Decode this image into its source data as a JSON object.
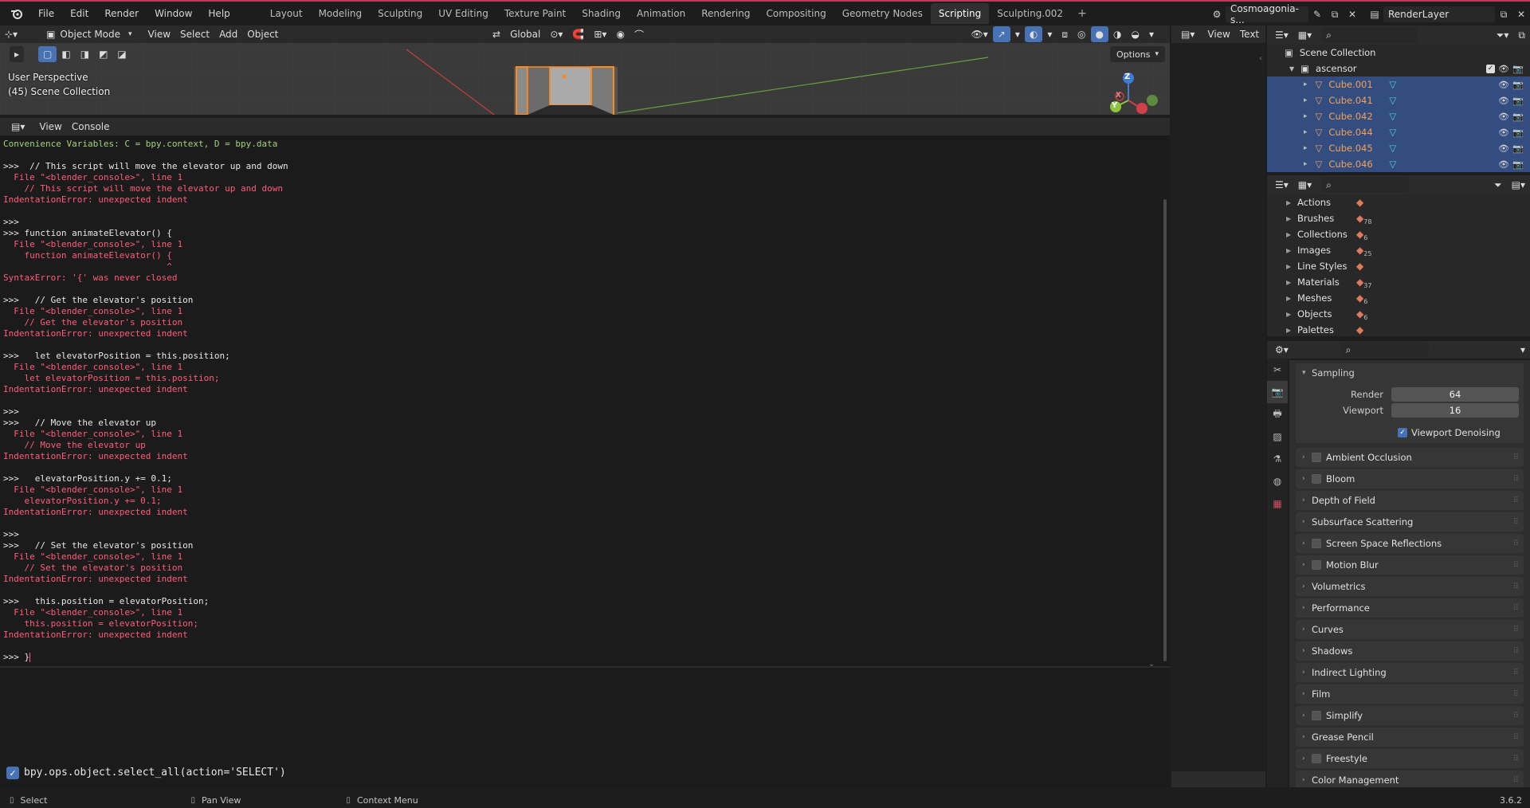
{
  "menu": [
    "File",
    "Edit",
    "Render",
    "Window",
    "Help"
  ],
  "workspaces": [
    "Layout",
    "Modeling",
    "Sculpting",
    "UV Editing",
    "Texture Paint",
    "Shading",
    "Animation",
    "Rendering",
    "Compositing",
    "Geometry Nodes",
    "Scripting",
    "Sculpting.002"
  ],
  "active_workspace": "Scripting",
  "scene_name": "Cosmoagonia-s...",
  "view_layer": "RenderLayer",
  "viewport": {
    "mode": "Object Mode",
    "menus": [
      "View",
      "Select",
      "Add",
      "Object"
    ],
    "transform": "Global",
    "options": "Options",
    "perspective": "User Perspective",
    "collection_info": "(45) Scene Collection",
    "axis_x": "X",
    "axis_y": "Y",
    "axis_z": "Z"
  },
  "console": {
    "menus": [
      "View",
      "Console"
    ],
    "lines": [
      {
        "t": "Convenience Variables: C = bpy.context, D = bpy.data",
        "c": "green"
      },
      {
        "t": "",
        "c": "white"
      },
      {
        "t": ">>>  // This script will move the elevator up and down",
        "c": "white"
      },
      {
        "t": "  File \"<blender_console>\", line 1",
        "c": "red"
      },
      {
        "t": "    // This script will move the elevator up and down",
        "c": "red"
      },
      {
        "t": "IndentationError: unexpected indent",
        "c": "red"
      },
      {
        "t": "",
        "c": "white"
      },
      {
        "t": ">>>",
        "c": "white"
      },
      {
        "t": ">>> function animateElevator() {",
        "c": "white"
      },
      {
        "t": "  File \"<blender_console>\", line 1",
        "c": "red"
      },
      {
        "t": "    function animateElevator() {",
        "c": "red"
      },
      {
        "t": "                               ^",
        "c": "red"
      },
      {
        "t": "SyntaxError: '{' was never closed",
        "c": "red"
      },
      {
        "t": "",
        "c": "white"
      },
      {
        "t": ">>>   // Get the elevator's position",
        "c": "white"
      },
      {
        "t": "  File \"<blender_console>\", line 1",
        "c": "red"
      },
      {
        "t": "    // Get the elevator's position",
        "c": "red"
      },
      {
        "t": "IndentationError: unexpected indent",
        "c": "red"
      },
      {
        "t": "",
        "c": "white"
      },
      {
        "t": ">>>   let elevatorPosition = this.position;",
        "c": "white"
      },
      {
        "t": "  File \"<blender_console>\", line 1",
        "c": "red"
      },
      {
        "t": "    let elevatorPosition = this.position;",
        "c": "red"
      },
      {
        "t": "IndentationError: unexpected indent",
        "c": "red"
      },
      {
        "t": "",
        "c": "white"
      },
      {
        "t": ">>>",
        "c": "white"
      },
      {
        "t": ">>>   // Move the elevator up",
        "c": "white"
      },
      {
        "t": "  File \"<blender_console>\", line 1",
        "c": "red"
      },
      {
        "t": "    // Move the elevator up",
        "c": "red"
      },
      {
        "t": "IndentationError: unexpected indent",
        "c": "red"
      },
      {
        "t": "",
        "c": "white"
      },
      {
        "t": ">>>   elevatorPosition.y += 0.1;",
        "c": "white"
      },
      {
        "t": "  File \"<blender_console>\", line 1",
        "c": "red"
      },
      {
        "t": "    elevatorPosition.y += 0.1;",
        "c": "red"
      },
      {
        "t": "IndentationError: unexpected indent",
        "c": "red"
      },
      {
        "t": "",
        "c": "white"
      },
      {
        "t": ">>>",
        "c": "white"
      },
      {
        "t": ">>>   // Set the elevator's position",
        "c": "white"
      },
      {
        "t": "  File \"<blender_console>\", line 1",
        "c": "red"
      },
      {
        "t": "    // Set the elevator's position",
        "c": "red"
      },
      {
        "t": "IndentationError: unexpected indent",
        "c": "red"
      },
      {
        "t": "",
        "c": "white"
      },
      {
        "t": ">>>   this.position = elevatorPosition;",
        "c": "white"
      },
      {
        "t": "  File \"<blender_console>\", line 1",
        "c": "red"
      },
      {
        "t": "    this.position = elevatorPosition;",
        "c": "red"
      },
      {
        "t": "IndentationError: unexpected indent",
        "c": "red"
      },
      {
        "t": "",
        "c": "white"
      },
      {
        "t": ">>> }",
        "c": "white"
      }
    ],
    "report": "bpy.ops.object.select_all(action='SELECT')"
  },
  "text_editor": {
    "menus": [
      "View",
      "Text"
    ]
  },
  "outliner": {
    "root": "Scene Collection",
    "collection": "ascensor",
    "objects": [
      "Cube.001",
      "Cube.041",
      "Cube.042",
      "Cube.044",
      "Cube.045",
      "Cube.046"
    ]
  },
  "datablocks": [
    {
      "name": "Actions",
      "count": ""
    },
    {
      "name": "Brushes",
      "count": "78"
    },
    {
      "name": "Collections",
      "count": "6"
    },
    {
      "name": "Images",
      "count": "25"
    },
    {
      "name": "Line Styles",
      "count": ""
    },
    {
      "name": "Materials",
      "count": "37"
    },
    {
      "name": "Meshes",
      "count": "6"
    },
    {
      "name": "Objects",
      "count": "6"
    },
    {
      "name": "Palettes",
      "count": ""
    }
  ],
  "properties": {
    "sampling": {
      "title": "Sampling",
      "render_label": "Render",
      "render_value": "64",
      "viewport_label": "Viewport",
      "viewport_value": "16",
      "denoise_label": "Viewport Denoising"
    },
    "panels": [
      {
        "label": "Ambient Occlusion",
        "checkbox": true
      },
      {
        "label": "Bloom",
        "checkbox": true
      },
      {
        "label": "Depth of Field",
        "checkbox": false
      },
      {
        "label": "Subsurface Scattering",
        "checkbox": false
      },
      {
        "label": "Screen Space Reflections",
        "checkbox": true
      },
      {
        "label": "Motion Blur",
        "checkbox": true
      },
      {
        "label": "Volumetrics",
        "checkbox": false
      },
      {
        "label": "Performance",
        "checkbox": false
      },
      {
        "label": "Curves",
        "checkbox": false
      },
      {
        "label": "Shadows",
        "checkbox": false
      },
      {
        "label": "Indirect Lighting",
        "checkbox": false
      },
      {
        "label": "Film",
        "checkbox": false
      },
      {
        "label": "Simplify",
        "checkbox": true
      },
      {
        "label": "Grease Pencil",
        "checkbox": false
      },
      {
        "label": "Freestyle",
        "checkbox": true
      },
      {
        "label": "Color Management",
        "checkbox": false
      }
    ]
  },
  "statusbar": {
    "select": "Select",
    "pan": "Pan View",
    "context": "Context Menu",
    "version": "3.6.2"
  },
  "colors": {
    "accent": "#4772b3",
    "error": "#ff5c7c",
    "ok": "#a6d27a",
    "object": "#f0a25a",
    "selection": "#334d80"
  }
}
